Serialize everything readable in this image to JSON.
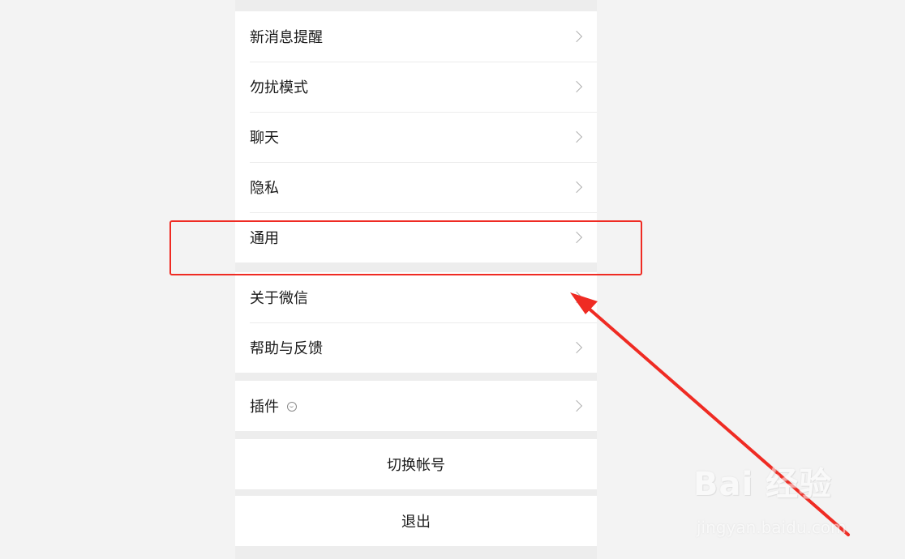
{
  "settings": {
    "group1": [
      {
        "label": "新消息提醒"
      },
      {
        "label": "勿扰模式"
      },
      {
        "label": "聊天"
      },
      {
        "label": "隐私"
      },
      {
        "label": "通用"
      }
    ],
    "group2": [
      {
        "label": "关于微信"
      },
      {
        "label": "帮助与反馈"
      }
    ],
    "group3": [
      {
        "label": "插件",
        "icon": "plugin-icon"
      }
    ],
    "switch_account_label": "切换帐号",
    "logout_label": "退出"
  },
  "annotation": {
    "highlight_color": "#ef2b23",
    "arrow_color": "#ef2b23",
    "highlighted_item": "通用"
  },
  "watermark": {
    "text": "Bai 经验",
    "subtext": "jingyan.baidu.com"
  }
}
